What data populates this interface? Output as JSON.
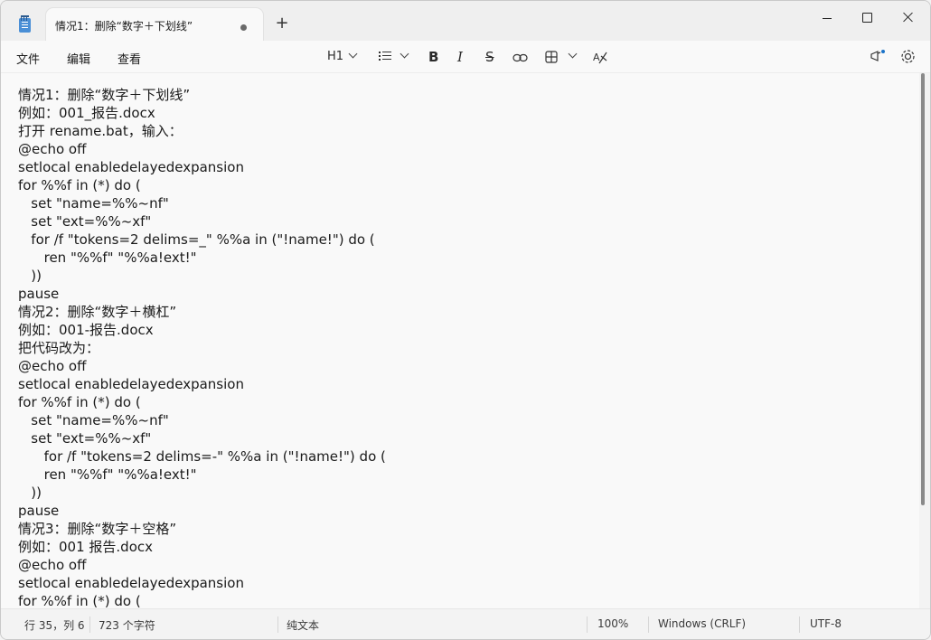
{
  "tab": {
    "title": "情况1：删除“数字＋下划线”"
  },
  "menu": {
    "file": "文件",
    "edit": "编辑",
    "view": "查看"
  },
  "toolbar": {
    "heading": "H1"
  },
  "content": {
    "lines": [
      "情况1：删除“数字＋下划线”",
      "例如：001_报告.docx",
      "打开 rename.bat，输入：",
      "@echo off",
      "setlocal enabledelayedexpansion",
      "for %%f in (*) do (",
      "   set \"name=%%~nf\"",
      "   set \"ext=%%~xf\"",
      "   for /f \"tokens=2 delims=_\" %%a in (\"!name!\") do (",
      "      ren \"%%f\" \"%%a!ext!\"",
      "   ))",
      "pause",
      "情况2：删除“数字＋横杠”",
      "例如：001-报告.docx",
      "把代码改为：",
      "@echo off",
      "setlocal enabledelayedexpansion",
      "for %%f in (*) do (",
      "   set \"name=%%~nf\"",
      "   set \"ext=%%~xf\"",
      "      for /f \"tokens=2 delims=-\" %%a in (\"!name!\") do (",
      "      ren \"%%f\" \"%%a!ext!\"",
      "   ))",
      "pause",
      "情况3：删除“数字＋空格”",
      "例如：001 报告.docx",
      "@echo off",
      "setlocal enabledelayedexpansion",
      "for %%f in (*) do ("
    ]
  },
  "status": {
    "position": "行 35，列 6",
    "chars": "723 个字符",
    "format": "纯文本",
    "zoom": "100%",
    "line_ending": "Windows (CRLF)",
    "encoding": "UTF-8"
  }
}
